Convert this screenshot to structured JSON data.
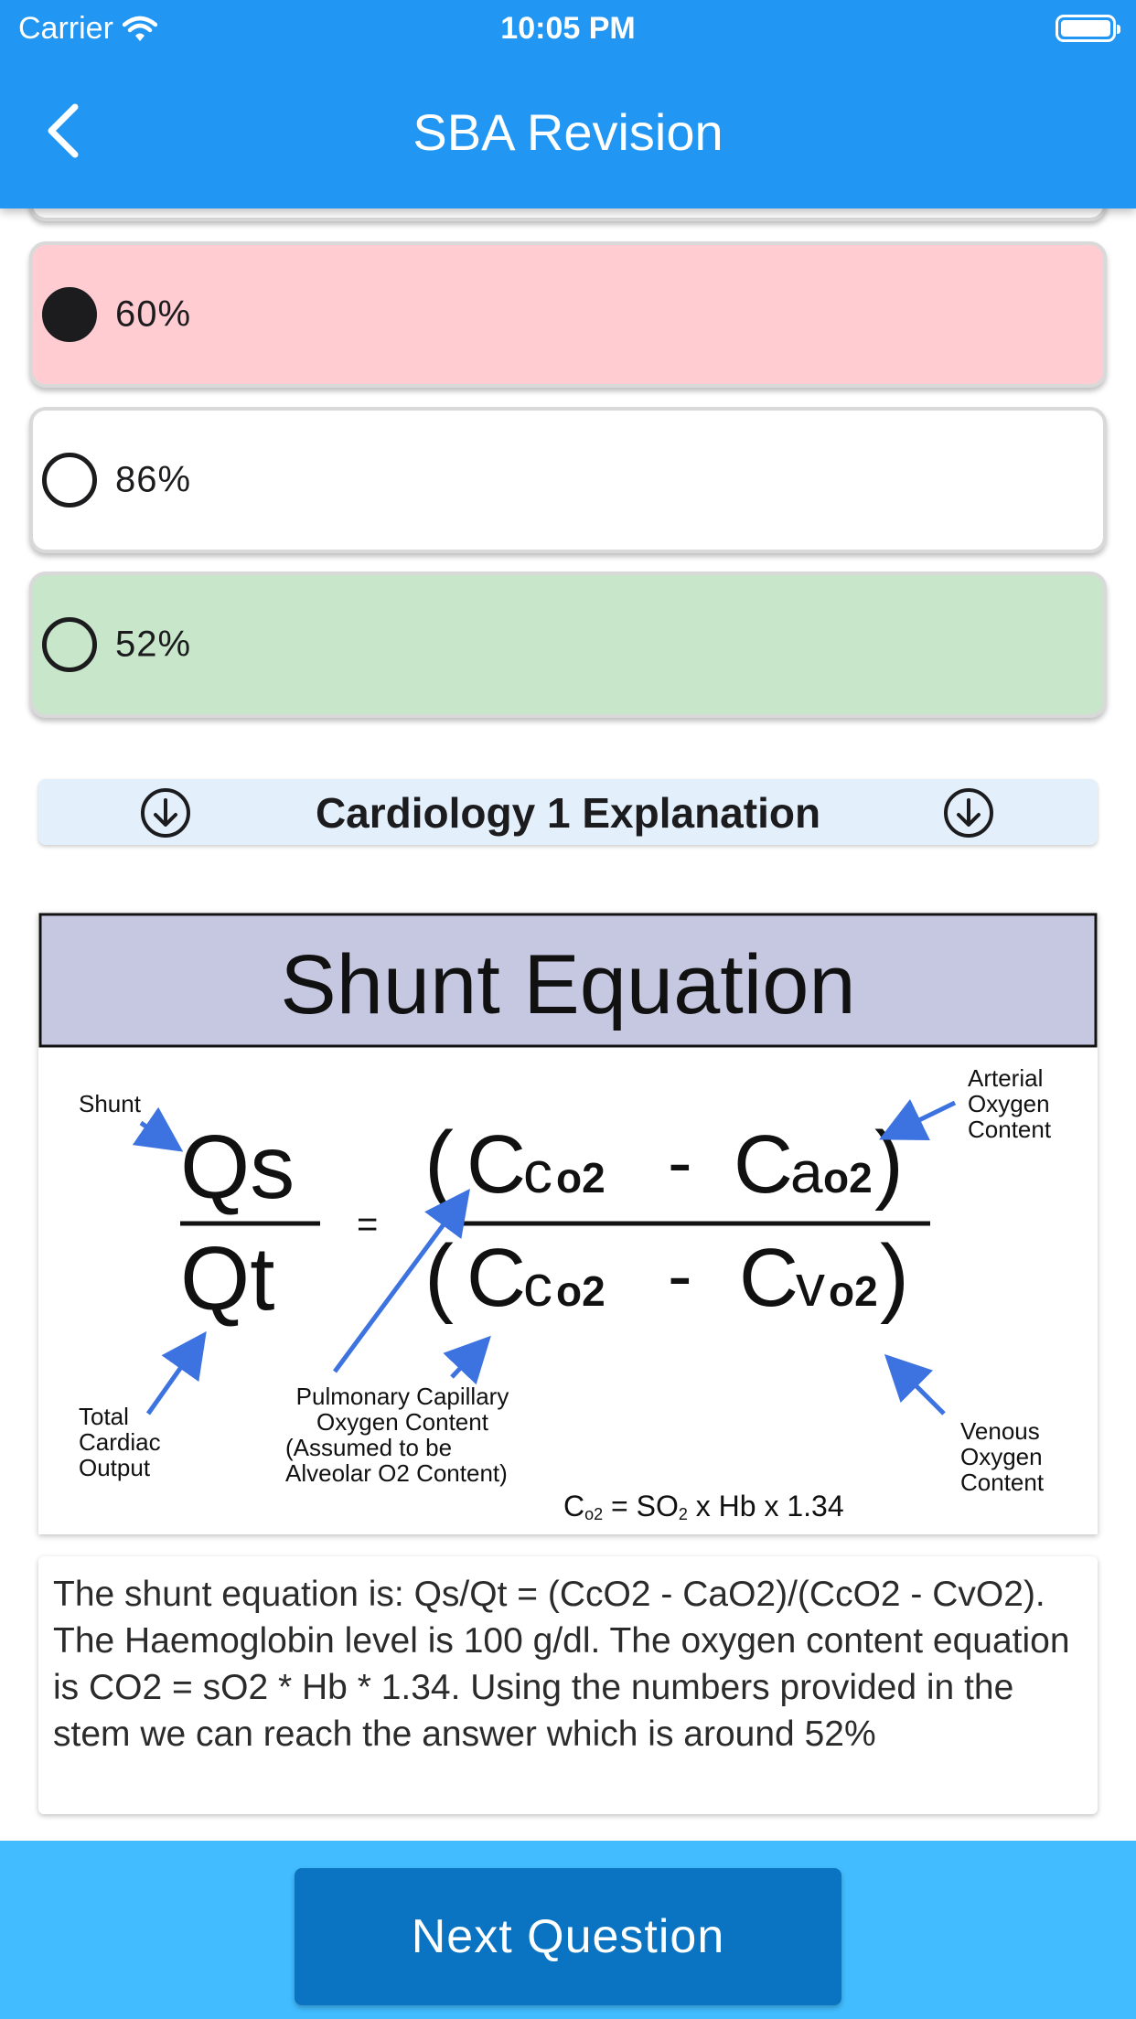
{
  "status_bar": {
    "carrier": "Carrier",
    "time": "10:05 PM"
  },
  "nav": {
    "title": "SBA Revision",
    "back_icon": "chevron-left-icon"
  },
  "options": [
    {
      "label": "60%",
      "selected": true,
      "state": "incorrect",
      "bg": "#ffccd2"
    },
    {
      "label": "86%",
      "selected": false,
      "state": "neutral",
      "bg": "#ffffff"
    },
    {
      "label": "52%",
      "selected": false,
      "state": "correct",
      "bg": "#c8e6c9"
    }
  ],
  "explanation": {
    "title": "Cardiology 1 Explanation",
    "icon": "arrow-down-circle-icon",
    "text": "The shunt equation is: Qs/Qt =  (CcO2 - CaO2)/(CcO2 - CvO2). The Haemoglobin level is 100 g/dl. The oxygen content equation is CO2 = sO2 * Hb * 1.34. Using the numbers provided in the stem we can reach the answer which is around 52%"
  },
  "diagram": {
    "title": "Shunt Equation",
    "labels": {
      "shunt": "Shunt",
      "total_1": "Total",
      "total_2": "Cardiac",
      "total_3": "Output",
      "arterial_1": "Arterial",
      "arterial_2": "Oxygen",
      "arterial_3": "Content",
      "venous_1": "Venous",
      "venous_2": "Oxygen",
      "venous_3": "Content",
      "pulm_1": "Pulmonary Capillary",
      "pulm_2": "Oxygen Content",
      "pulm_3": "(Assumed to be",
      "pulm_4": "Alveolar O2 Content)"
    },
    "eq": {
      "qs": "Qs",
      "qt": "Qt",
      "equals": "=",
      "open_paren": "(",
      "close_paren": ")",
      "c": "C",
      "c_sub": "c",
      "a_sub": "a",
      "v_sub": "v",
      "o2": "o2",
      "minus": "-"
    },
    "footer": {
      "c": "C",
      "sub": "o2",
      "rest1": " = SO",
      "two": "2",
      "rest2": " x Hb x 1.34"
    },
    "colors": {
      "title_bg": "#c5c8e0",
      "arrow": "#3d73e0"
    }
  },
  "bottom": {
    "next_label": "Next Question"
  },
  "colors": {
    "header": "#2196f3",
    "bottom_bar": "#42bcff",
    "button": "#0a74c2",
    "expl_bg": "#e3f0fb"
  }
}
